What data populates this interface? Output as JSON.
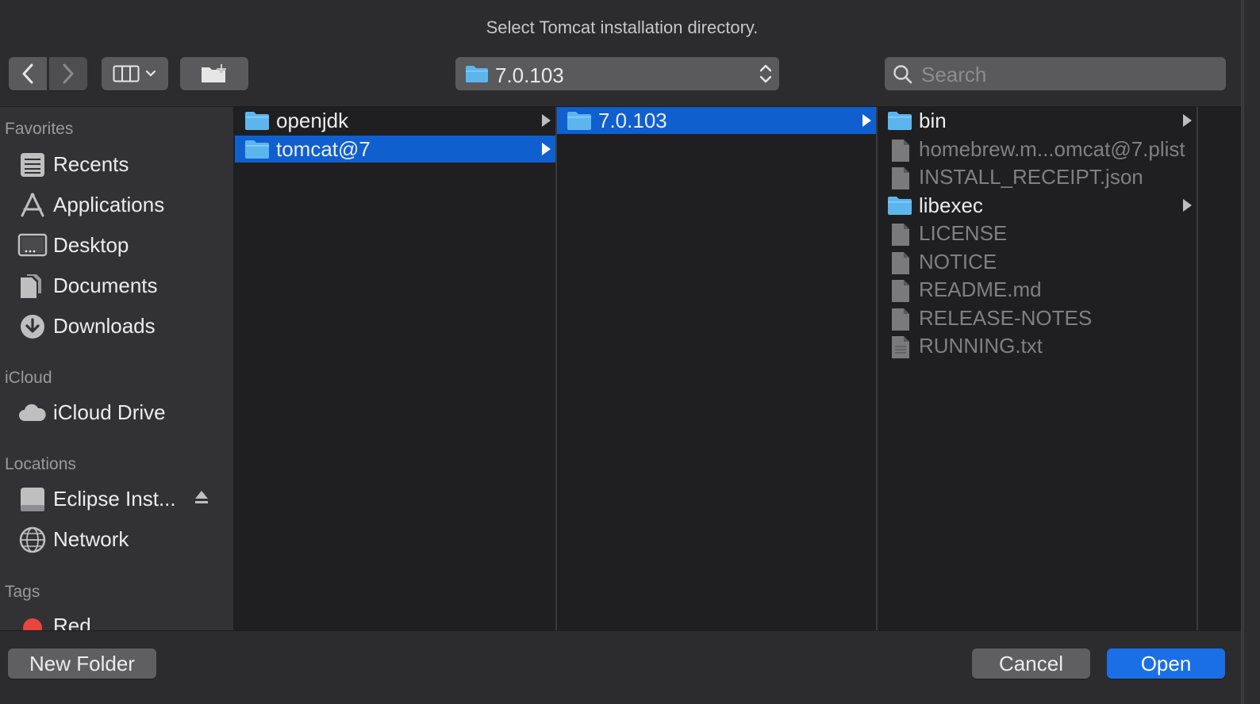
{
  "dialog": {
    "title": "Select Tomcat installation directory."
  },
  "toolbar": {
    "path_popup_label": "7.0.103",
    "search_placeholder": "Search"
  },
  "sidebar": {
    "sections": [
      {
        "heading": "Favorites",
        "items": [
          {
            "label": "Recents",
            "icon": "recents-icon"
          },
          {
            "label": "Applications",
            "icon": "applications-icon"
          },
          {
            "label": "Desktop",
            "icon": "desktop-icon"
          },
          {
            "label": "Documents",
            "icon": "documents-icon"
          },
          {
            "label": "Downloads",
            "icon": "downloads-icon"
          }
        ]
      },
      {
        "heading": "iCloud",
        "items": [
          {
            "label": "iCloud Drive",
            "icon": "cloud-icon"
          }
        ]
      },
      {
        "heading": "Locations",
        "items": [
          {
            "label": "Eclipse Inst...",
            "icon": "disk-icon"
          },
          {
            "label": "Network",
            "icon": "network-icon"
          }
        ]
      },
      {
        "heading": "Tags",
        "items": [
          {
            "label": "Red",
            "icon": "red-tag-icon"
          }
        ]
      }
    ]
  },
  "columns": {
    "col1": [
      {
        "name": "openjdk",
        "type": "folder",
        "selected": false
      },
      {
        "name": "tomcat@7",
        "type": "folder",
        "selected": true
      }
    ],
    "col2": [
      {
        "name": "7.0.103",
        "type": "folder",
        "selected": true
      }
    ],
    "col3": [
      {
        "name": "bin",
        "type": "folder"
      },
      {
        "name": "homebrew.m...omcat@7.plist",
        "type": "file"
      },
      {
        "name": "INSTALL_RECEIPT.json",
        "type": "file"
      },
      {
        "name": "libexec",
        "type": "folder"
      },
      {
        "name": "LICENSE",
        "type": "file"
      },
      {
        "name": "NOTICE",
        "type": "file"
      },
      {
        "name": "README.md",
        "type": "file"
      },
      {
        "name": "RELEASE-NOTES",
        "type": "file"
      },
      {
        "name": "RUNNING.txt",
        "type": "file"
      }
    ]
  },
  "buttons": {
    "new_folder": "New Folder",
    "cancel": "Cancel",
    "open": "Open"
  },
  "colors": {
    "selection": "#0f5fcf",
    "primary_button": "#1a6fe6",
    "folder": "#5db5ee",
    "red_tag": "#e8453c"
  }
}
